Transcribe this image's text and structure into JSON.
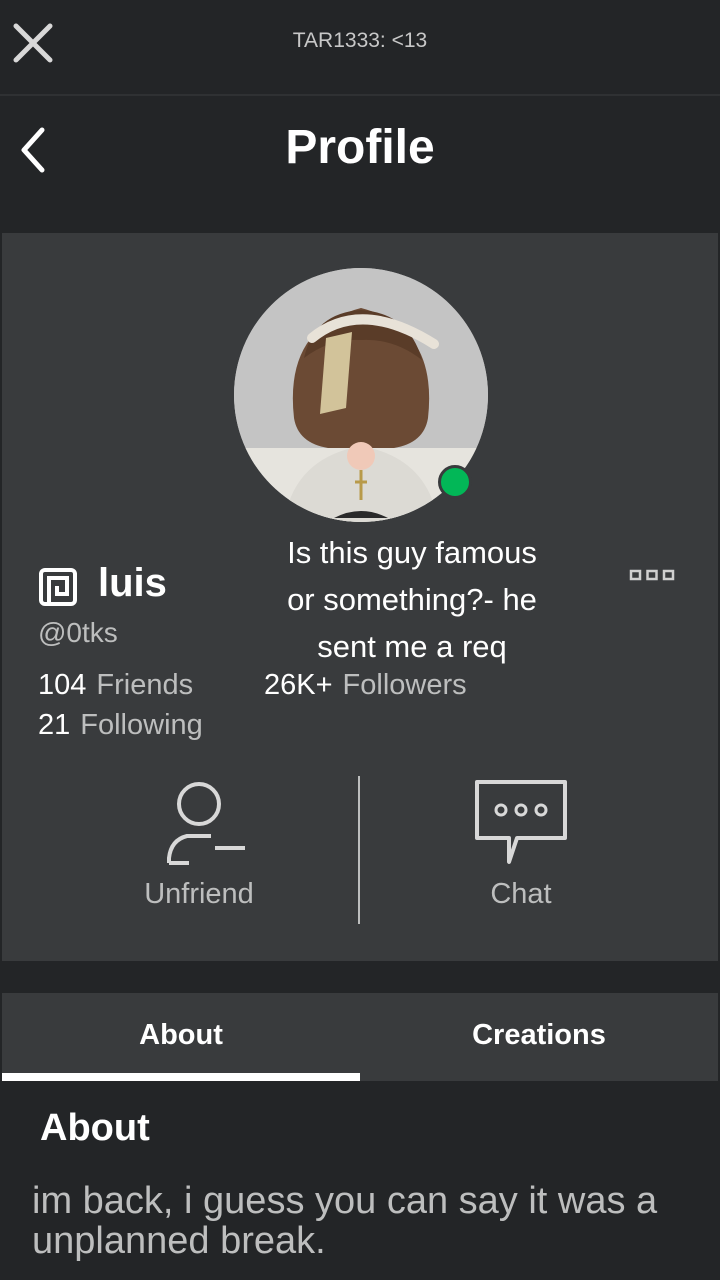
{
  "topbar": {
    "title": "TAR1333: <13"
  },
  "header": {
    "title": "Profile"
  },
  "profile": {
    "display_name": "luis",
    "username": "@0tks",
    "online": true,
    "friends_count": "104",
    "friends_label": "Friends",
    "followers_count": "26K+",
    "followers_label": "Followers",
    "following_count": "21",
    "following_label": "Following"
  },
  "caption": {
    "line1": "Is this guy famous",
    "line2": "or something?- he",
    "line3": "sent me a req"
  },
  "actions": {
    "unfriend_label": "Unfriend",
    "chat_label": "Chat"
  },
  "tabs": [
    {
      "label": "About",
      "selected": true
    },
    {
      "label": "Creations",
      "selected": false
    }
  ],
  "about": {
    "heading": "About",
    "text": "im back, i guess you can say it was a unplanned break."
  },
  "colors": {
    "background": "#232527",
    "card": "#393b3d",
    "online": "#02b757",
    "muted_text": "#bdbebe"
  }
}
